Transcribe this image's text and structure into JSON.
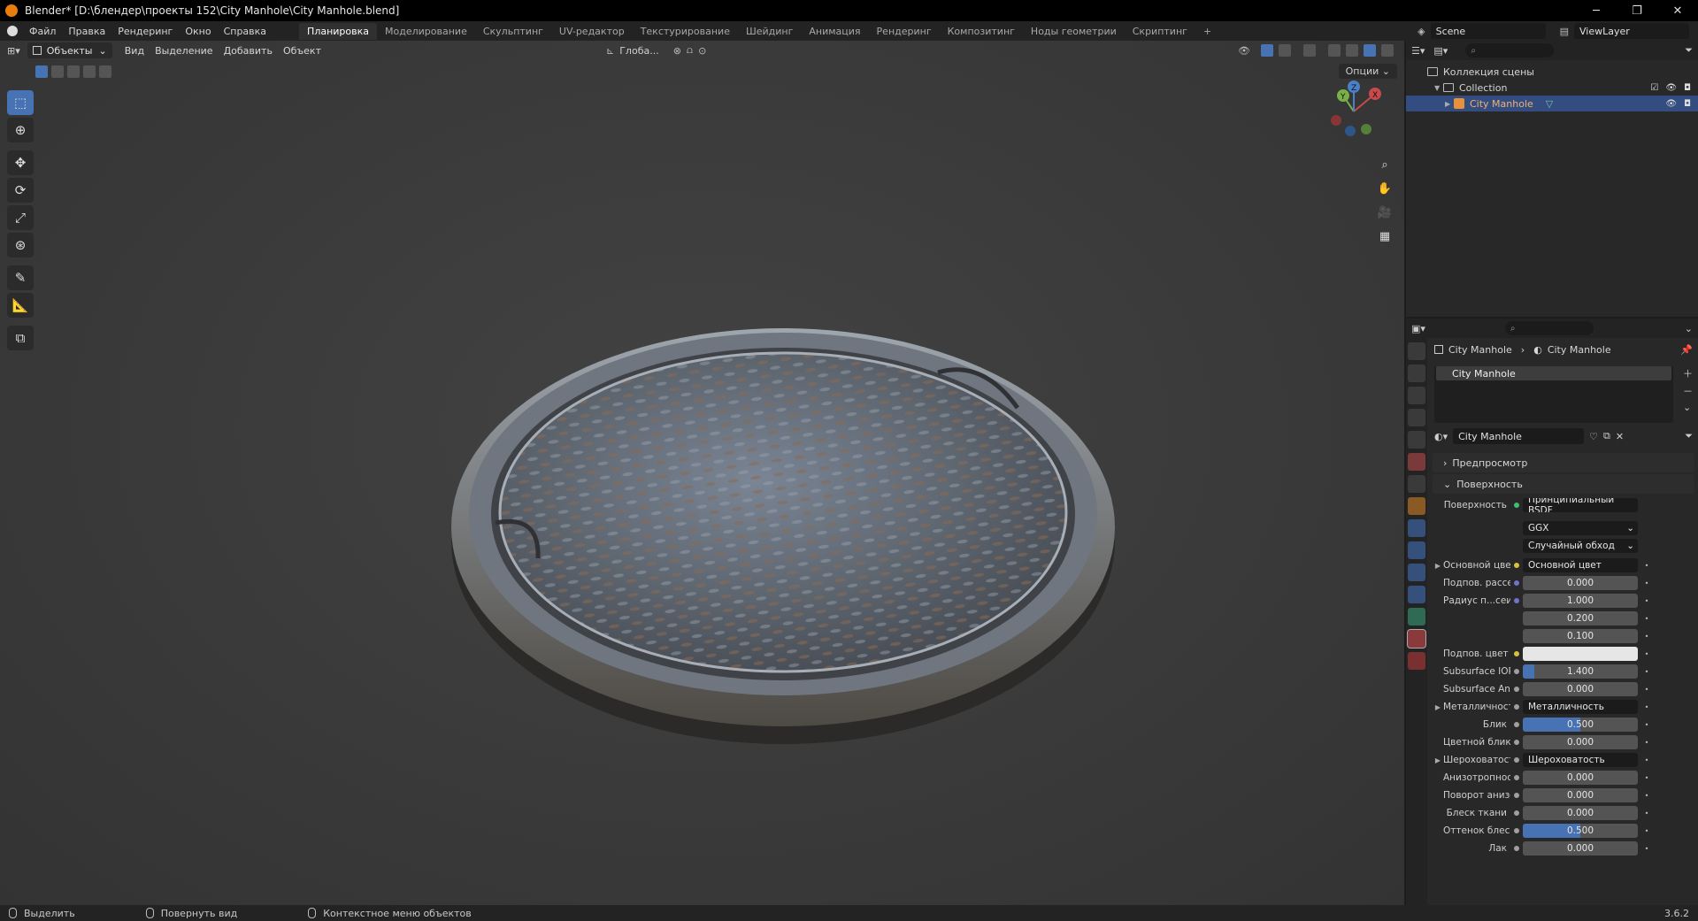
{
  "window": {
    "title": "Blender* [D:\\блендер\\проекты 152\\City Manhole\\City Manhole.blend]",
    "minimize": "─",
    "maximize": "❐",
    "close": "✕"
  },
  "menu": {
    "items": [
      "Файл",
      "Правка",
      "Рендеринг",
      "Окно",
      "Справка"
    ],
    "workspaces": [
      "Планировка",
      "Моделирование",
      "Скульптинг",
      "UV-редактор",
      "Текстурирование",
      "Шейдинг",
      "Анимация",
      "Рендеринг",
      "Композитинг",
      "Ноды геометрии",
      "Скриптинг",
      "+"
    ],
    "active_workspace": "Планировка",
    "scene": "Scene",
    "view_layer": "ViewLayer"
  },
  "viewport": {
    "mode": "Объекты",
    "menus": [
      "Вид",
      "Выделение",
      "Добавить",
      "Объект"
    ],
    "orientation": "Глоба...",
    "options": "Опции",
    "gizmo": {
      "x": "X",
      "y": "Y",
      "z": "Z"
    },
    "tools": [
      "select-box",
      "cursor",
      "move",
      "rotate",
      "scale",
      "transform",
      "annotate",
      "measure",
      "add-cube"
    ]
  },
  "outliner": {
    "root": "Коллекция сцены",
    "collection": "Collection",
    "object": "City Manhole"
  },
  "properties": {
    "breadcrumb_object": "City Manhole",
    "breadcrumb_material": "City Manhole",
    "slot": "City Manhole",
    "material_name": "City Manhole",
    "sections": {
      "preview": "Предпросмотр",
      "surface": "Поверхность"
    },
    "surface_label": "Поверхность",
    "surface_value": "Принципиальный BSDF",
    "distribution": "GGX",
    "subsurface_method": "Случайный обход",
    "rows": [
      {
        "label": "Основной цвет",
        "value": "Основной цвет",
        "kind": "link",
        "dot": "#d6c23a",
        "expand": true
      },
      {
        "label": "Подпов. рассеива...",
        "value": "0.000",
        "kind": "num",
        "dot": "#6e75c6"
      },
      {
        "label": "Радиус п...сеивания",
        "value": "1.000",
        "kind": "num",
        "dot": "#6e75c6"
      },
      {
        "label": "",
        "value": "0.200",
        "kind": "num",
        "dot": ""
      },
      {
        "label": "",
        "value": "0.100",
        "kind": "num",
        "dot": ""
      },
      {
        "label": "Подпов. цвет",
        "value": "",
        "kind": "color",
        "dot": "#d6c23a"
      },
      {
        "label": "Subsurface IOR",
        "value": "1.400",
        "kind": "num",
        "dot": "#9f9f9f",
        "fill": 0.1
      },
      {
        "label": "Subsurface Anisotr...",
        "value": "0.000",
        "kind": "num",
        "dot": "#9f9f9f"
      },
      {
        "label": "Металличность",
        "value": "Металличность",
        "kind": "link",
        "dot": "#9f9f9f",
        "expand": true
      },
      {
        "label": "Блик",
        "value": "0.500",
        "kind": "num",
        "dot": "#9f9f9f",
        "fill": 0.5
      },
      {
        "label": "Цветной блик",
        "value": "0.000",
        "kind": "num",
        "dot": "#9f9f9f"
      },
      {
        "label": "Шероховатость",
        "value": "Шероховатость",
        "kind": "link",
        "dot": "#9f9f9f",
        "expand": true
      },
      {
        "label": "Анизотропность",
        "value": "0.000",
        "kind": "num",
        "dot": "#9f9f9f"
      },
      {
        "label": "Поворот анизотро...",
        "value": "0.000",
        "kind": "num",
        "dot": "#9f9f9f"
      },
      {
        "label": "Блеск ткани",
        "value": "0.000",
        "kind": "num",
        "dot": "#9f9f9f"
      },
      {
        "label": "Оттенок блеска тк...",
        "value": "0.500",
        "kind": "num",
        "dot": "#9f9f9f",
        "fill": 0.5
      },
      {
        "label": "Лак",
        "value": "0.000",
        "kind": "num",
        "dot": "#9f9f9f"
      }
    ]
  },
  "statusbar": {
    "select": "Выделить",
    "rotate": "Повернуть вид",
    "context": "Контекстное меню объектов",
    "version": "3.6.2"
  },
  "colors": {
    "accent": "#4772b3",
    "selected_row": "#334d80",
    "object_orange": "#e8913a"
  }
}
